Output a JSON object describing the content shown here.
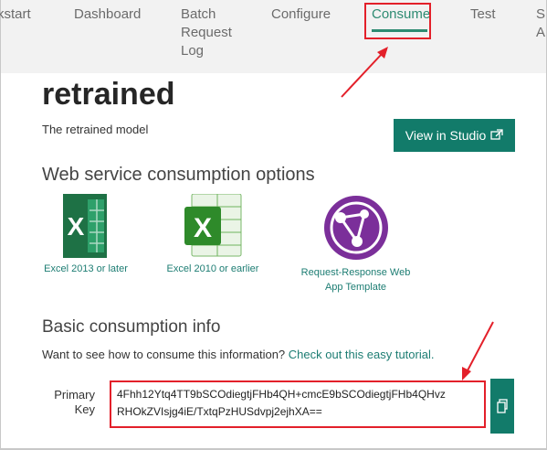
{
  "nav": {
    "quickstart": "kstart",
    "dashboard": "Dashboard",
    "batch_log": "Batch\nRequest\nLog",
    "configure": "Configure",
    "consume": "Consume",
    "test": "Test",
    "extra": "S\nA"
  },
  "model": {
    "name": "retrained",
    "description": "The retrained model"
  },
  "studio_button": {
    "label": "View in Studio",
    "icon": "external-link-icon"
  },
  "options": {
    "heading": "Web service consumption options",
    "items": [
      {
        "label": "Excel 2013 or later",
        "icon": "excel-2013-icon"
      },
      {
        "label": "Excel 2010 or earlier",
        "icon": "excel-2010-icon"
      },
      {
        "label": "Request-Response Web\nApp Template",
        "icon": "web-app-icon"
      }
    ]
  },
  "basic": {
    "heading": "Basic consumption info",
    "prompt": "Want to see how to consume this information?",
    "tutorial_link": "Check out this easy tutorial.",
    "primary_key_label": "Primary\nKey",
    "primary_key_line1": "4Fhh12Ytq4TT9bSCOdiegtjFHb4QH+cmcE9bSCOdiegtjFHb4QHvz",
    "primary_key_line2": "RHOkZVIsjg4iE/TxtqPzHUSdvpj2ejhXA=="
  },
  "colors": {
    "accent": "#127b6a",
    "active_tab": "#2e8b72",
    "highlight": "#e3202a",
    "link": "#1d7d73"
  }
}
